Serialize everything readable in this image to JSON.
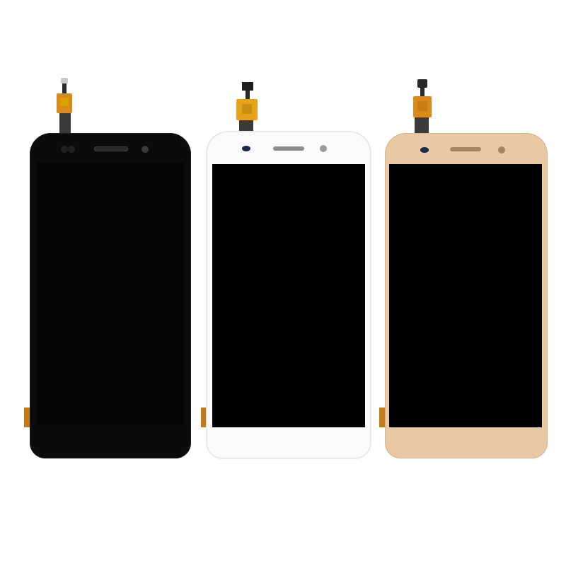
{
  "scene": {
    "background_color": "#ffffff",
    "items": [
      {
        "name": "black-lcd-panel",
        "frame_color": "#0b0b0b"
      },
      {
        "name": "white-lcd-panel",
        "frame_color": "#fbfbfb"
      },
      {
        "name": "gold-lcd-panel",
        "frame_color": "#e8c9a3"
      }
    ]
  }
}
